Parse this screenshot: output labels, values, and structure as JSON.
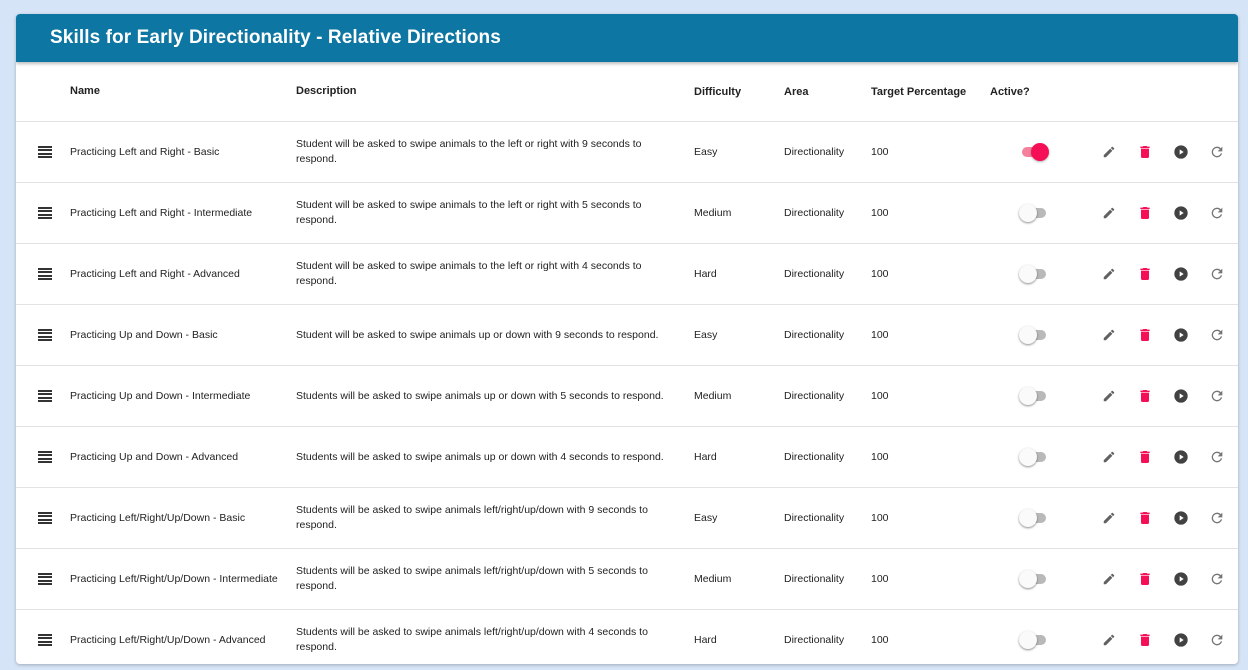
{
  "title": "Skills for Early Directionality - Relative Directions",
  "colors": {
    "header": "#0e76a2",
    "accent": "#f50f57",
    "icon": "#616161"
  },
  "columns": {
    "name": "Name",
    "description": "Description",
    "difficulty": "Difficulty",
    "area": "Area",
    "target": "Target Percentage",
    "active": "Active?"
  },
  "icons": {
    "drag": "drag-handle-icon",
    "edit": "pencil-icon",
    "delete": "trash-icon",
    "play": "play-circle-icon",
    "reset": "refresh-icon"
  },
  "rows": [
    {
      "name": "Practicing Left and Right - Basic",
      "description": "Student will be asked to swipe animals to the left or right with 9 seconds to respond.",
      "difficulty": "Easy",
      "area": "Directionality",
      "target": "100",
      "active": true
    },
    {
      "name": "Practicing Left and Right - Intermediate",
      "description": "Student will be asked to swipe animals to the left or right with 5 seconds to respond.",
      "difficulty": "Medium",
      "area": "Directionality",
      "target": "100",
      "active": false
    },
    {
      "name": "Practicing Left and Right - Advanced",
      "description": "Student will be asked to swipe animals to the left or right with 4 seconds to respond.",
      "difficulty": "Hard",
      "area": "Directionality",
      "target": "100",
      "active": false
    },
    {
      "name": "Practicing Up and Down - Basic",
      "description": "Student will be asked to swipe animals up or down with 9 seconds to respond.",
      "difficulty": "Easy",
      "area": "Directionality",
      "target": "100",
      "active": false
    },
    {
      "name": "Practicing Up and Down - Intermediate",
      "description": "Students will be asked to swipe animals up or down with 5 seconds to respond.",
      "difficulty": "Medium",
      "area": "Directionality",
      "target": "100",
      "active": false
    },
    {
      "name": "Practicing Up and Down - Advanced",
      "description": "Students will be asked to swipe animals up or down with 4 seconds to respond.",
      "difficulty": "Hard",
      "area": "Directionality",
      "target": "100",
      "active": false
    },
    {
      "name": "Practicing Left/Right/Up/Down - Basic",
      "description": "Students will be asked to swipe animals left/right/up/down with 9 seconds to respond.",
      "difficulty": "Easy",
      "area": "Directionality",
      "target": "100",
      "active": false
    },
    {
      "name": "Practicing Left/Right/Up/Down - Intermediate",
      "description": "Students will be asked to swipe animals left/right/up/down with 5 seconds to respond.",
      "difficulty": "Medium",
      "area": "Directionality",
      "target": "100",
      "active": false
    },
    {
      "name": "Practicing Left/Right/Up/Down - Advanced",
      "description": "Students will be asked to swipe animals left/right/up/down with 4 seconds to respond.",
      "difficulty": "Hard",
      "area": "Directionality",
      "target": "100",
      "active": false
    }
  ]
}
